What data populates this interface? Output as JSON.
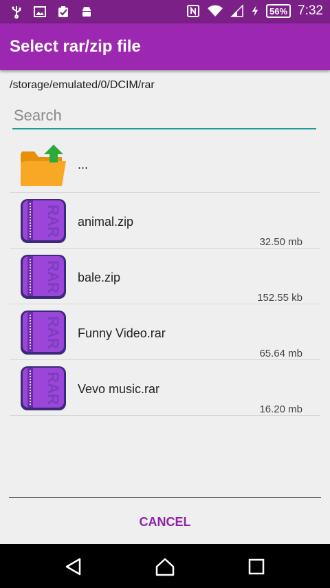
{
  "status_bar": {
    "battery_percent": "56%",
    "time": "7:32",
    "icons": [
      "usb-icon",
      "image-icon",
      "clipboard-check-icon",
      "android-icon",
      "nfc-icon",
      "wifi-icon",
      "signal-icon",
      "charging-icon",
      "battery-icon"
    ]
  },
  "app_bar": {
    "title": "Select rar/zip file"
  },
  "path": "/storage/emulated/0/DCIM/rar",
  "search": {
    "placeholder": "Search",
    "value": ""
  },
  "files": [
    {
      "name": "...",
      "size": "",
      "icon": "folder-up-icon"
    },
    {
      "name": "animal.zip",
      "size": "32.50 mb",
      "icon": "rar-archive-icon"
    },
    {
      "name": "bale.zip",
      "size": "152.55 kb",
      "icon": "rar-archive-icon"
    },
    {
      "name": "Funny Video.rar",
      "size": "65.64 mb",
      "icon": "rar-archive-icon"
    },
    {
      "name": "Vevo music.rar",
      "size": "16.20 mb",
      "icon": "rar-archive-icon"
    }
  ],
  "cancel_label": "CANCEL",
  "colors": {
    "status_bar": "#7b2087",
    "app_bar": "#9c27b0",
    "accent": "#8e24aa",
    "search_underline": "#1e9a9a"
  },
  "nav_icons": [
    "back-icon",
    "home-icon",
    "recents-icon"
  ]
}
